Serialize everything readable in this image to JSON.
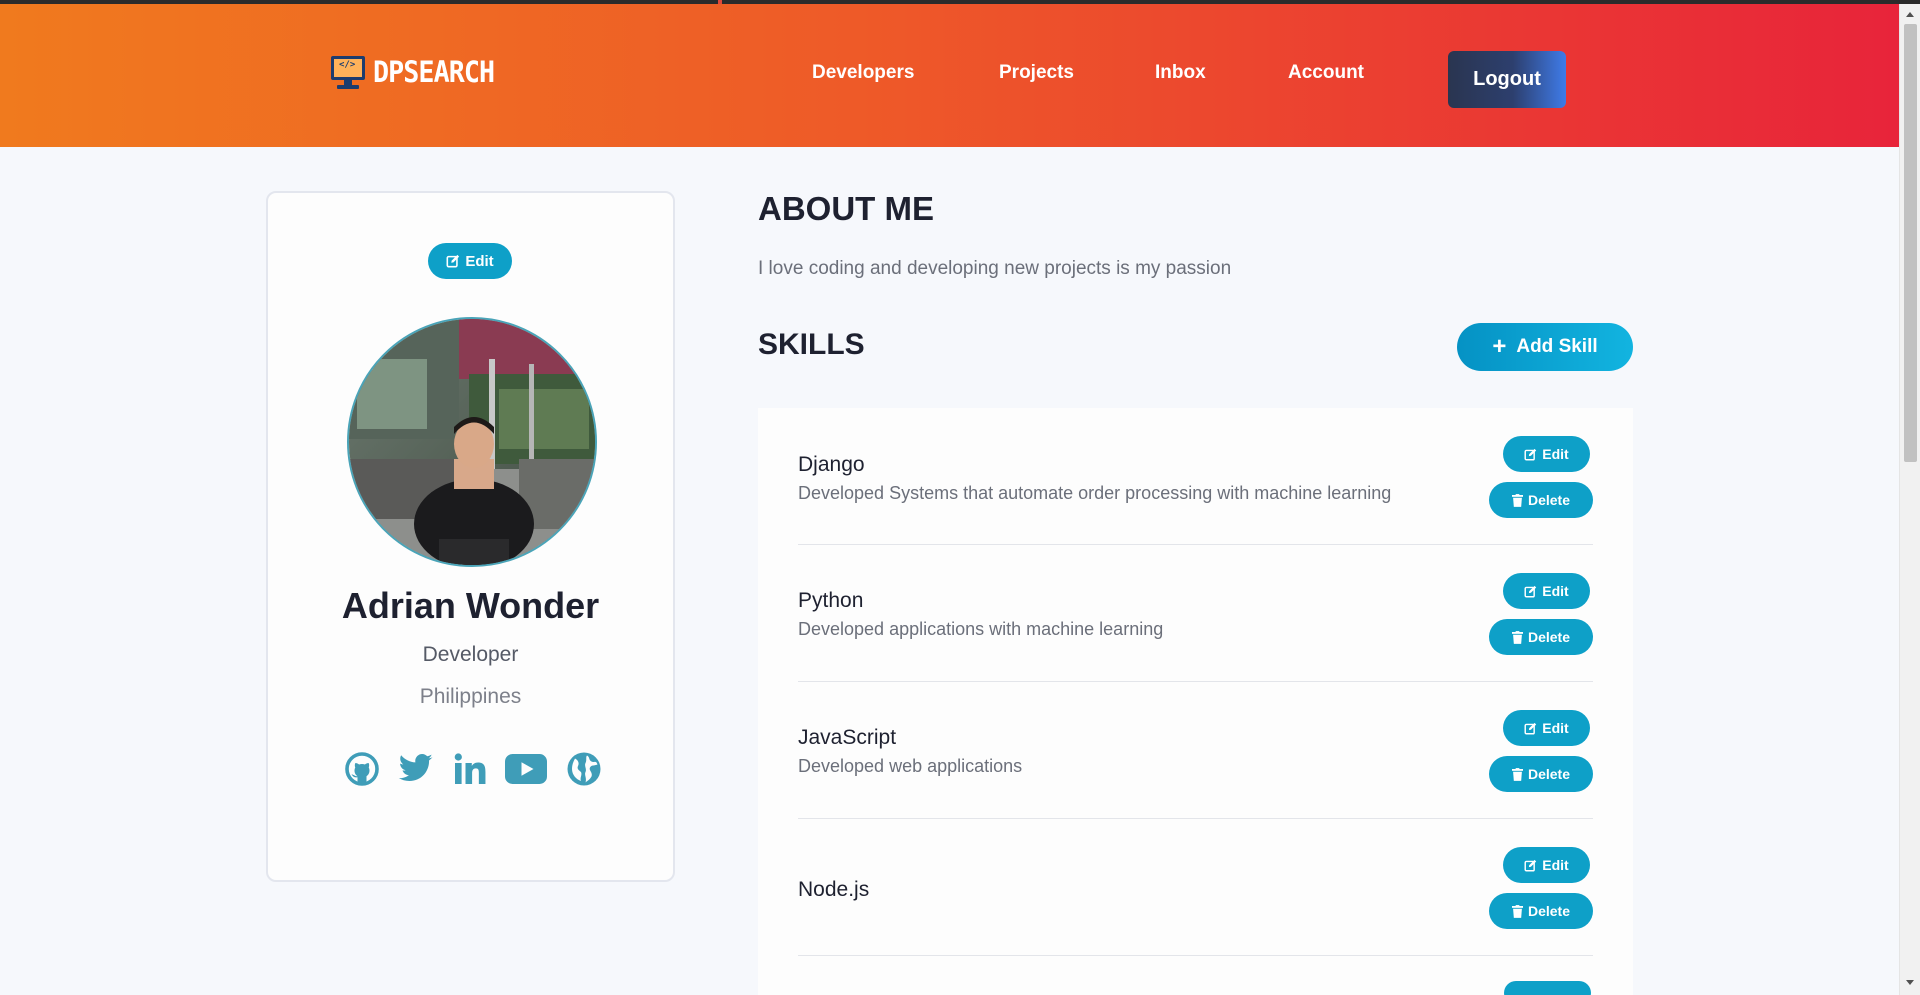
{
  "header": {
    "logo_text": "DPSEARCH",
    "logo_icon_text": "</>",
    "nav": [
      {
        "label": "Developers"
      },
      {
        "label": "Projects"
      },
      {
        "label": "Inbox"
      },
      {
        "label": "Account"
      }
    ],
    "logout_label": "Logout"
  },
  "profile": {
    "edit_label": "Edit",
    "name": "Adrian Wonder",
    "role": "Developer",
    "location": "Philippines",
    "socials": [
      "github-icon",
      "twitter-icon",
      "linkedin-icon",
      "youtube-icon",
      "globe-icon"
    ]
  },
  "about": {
    "title": "ABOUT ME",
    "text": "I love coding and developing new projects is my passion"
  },
  "skills": {
    "title": "SKILLS",
    "add_label": "Add Skill",
    "items": [
      {
        "name": "Django",
        "description": "Developed Systems that automate order processing with machine learning",
        "edit_label": "Edit",
        "delete_label": "Delete"
      },
      {
        "name": "Python",
        "description": "Developed applications with machine learning",
        "edit_label": "Edit",
        "delete_label": "Delete"
      },
      {
        "name": "JavaScript",
        "description": "Developed web applications",
        "edit_label": "Edit",
        "delete_label": "Delete"
      },
      {
        "name": "Node.js",
        "description": "",
        "edit_label": "Edit",
        "delete_label": "Delete"
      }
    ]
  },
  "colors": {
    "header_start": "#f07a1e",
    "header_end": "#e8243a",
    "accent": "#0ea0c8",
    "icon_color": "#3f9db8",
    "logout_bg": "#2a3550"
  }
}
